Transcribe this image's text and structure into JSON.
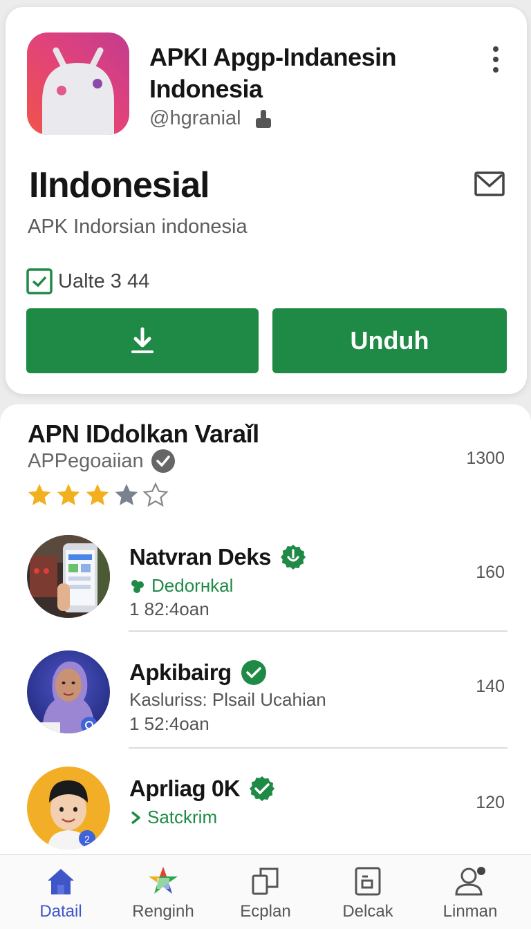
{
  "app": {
    "title": "APKI Apgp-Indanesin Indonesia",
    "handle": "@hgranial",
    "heading": "IIndonesial",
    "subtitle": "APK Indorsian indonesia",
    "update_label": "Ualte 3 44",
    "download_icon": "download-icon",
    "unduh_label": "Unduh"
  },
  "section": {
    "title": "APN IDdolkan Varaǐl",
    "subtitle": "APPegoaiian",
    "count": "1300",
    "rating_stars": 3,
    "rating_max": 5
  },
  "items": [
    {
      "name": "Natvran Deks",
      "line2": "Dedorнkal",
      "line3": "1 82:4oan",
      "count": "160"
    },
    {
      "name": "Apkibairg",
      "line2": "Kaslurіss: Plsail Ucahian",
      "line3": "1 52:4oan",
      "count": "140"
    },
    {
      "name": "Aprliag 0K",
      "line2": "Satckrim",
      "count": "120"
    }
  ],
  "nav": [
    {
      "label": "Datail",
      "icon": "home-icon",
      "active": true
    },
    {
      "label": "Renginh",
      "icon": "star-app-icon",
      "active": false
    },
    {
      "label": "Ecplan",
      "icon": "copy-icon",
      "active": false
    },
    {
      "label": "Delcak",
      "icon": "document-icon",
      "active": false
    },
    {
      "label": "Linman",
      "icon": "profile-icon",
      "active": false
    }
  ],
  "colors": {
    "accent_green": "#1e8a45",
    "star_gold": "#f2b01e",
    "nav_active": "#3e56c8"
  }
}
